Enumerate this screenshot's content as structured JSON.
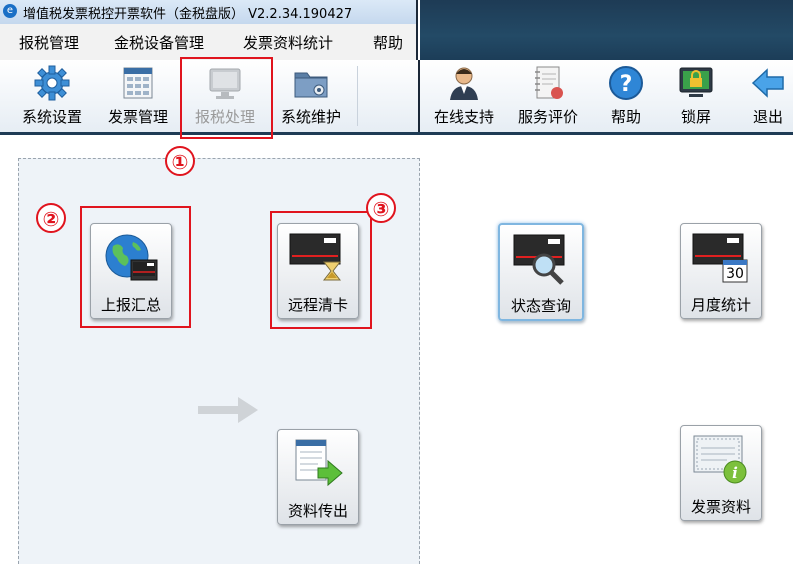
{
  "window": {
    "title": "增值税发票税控开票软件（金税盘版） V2.2.34.190427"
  },
  "menu": {
    "items": [
      "报税管理",
      "金税设备管理",
      "发票资料统计",
      "帮助"
    ]
  },
  "toolbar_left": {
    "items": [
      {
        "label": "系统设置",
        "icon": "gear-icon"
      },
      {
        "label": "发票管理",
        "icon": "invoice-grid-icon"
      },
      {
        "label": "报税处理",
        "icon": "monitor-icon",
        "state": "disabled"
      },
      {
        "label": "系统维护",
        "icon": "folder-gear-icon"
      }
    ]
  },
  "toolbar_right": {
    "items": [
      {
        "label": "在线支持",
        "icon": "support-person-icon"
      },
      {
        "label": "服务评价",
        "icon": "notebook-icon"
      },
      {
        "label": "帮助",
        "icon": "help-icon"
      },
      {
        "label": "锁屏",
        "icon": "lock-screen-icon"
      },
      {
        "label": "退出",
        "icon": "exit-arrow-icon"
      }
    ]
  },
  "functions": {
    "report_summary": {
      "label": "上报汇总",
      "icon": "globe-card-icon"
    },
    "remote_clear": {
      "label": "远程清卡",
      "icon": "card-hourglass-icon"
    },
    "status_query": {
      "label": "状态查询",
      "icon": "card-magnifier-icon"
    },
    "monthly_stats": {
      "label": "月度统计",
      "icon": "card-calendar-icon",
      "calendar_day": "30"
    },
    "data_export": {
      "label": "资料传出",
      "icon": "document-export-icon"
    },
    "invoice_data": {
      "label": "发票资料",
      "icon": "invoice-info-icon"
    }
  },
  "callouts": [
    "①",
    "②",
    "③"
  ],
  "colors": {
    "highlight_red": "#e0141e",
    "accent_blue": "#1a6fc6",
    "dark_header": "#1e3b55"
  }
}
